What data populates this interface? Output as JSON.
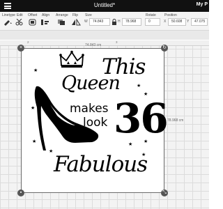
{
  "app": {
    "document_title": "Untitled*",
    "project_label": "My P"
  },
  "toolbar": {
    "groups": [
      {
        "label": "Linetype"
      },
      {
        "label": "Edit"
      },
      {
        "label": "Offset"
      },
      {
        "label": "Align"
      },
      {
        "label": "Arrange"
      },
      {
        "label": "Flip"
      },
      {
        "label": "Size"
      },
      {
        "label": "Rotate"
      },
      {
        "label": "Position"
      }
    ],
    "size": {
      "w_label": "W",
      "w_value": "74.843",
      "h_label": "H",
      "h_value": "78.968"
    },
    "rotate": {
      "value": "0"
    },
    "position": {
      "x_label": "X",
      "x_value": "50.608",
      "y_label": "Y",
      "y_value": "47.075"
    }
  },
  "ruler": {
    "label_left": "2",
    "label_right": "3"
  },
  "selection": {
    "width_readout": "74.843 cm",
    "height_readout": "78.968 cm"
  },
  "artwork": {
    "line1": "This",
    "line2": "Queen",
    "line3": "makes",
    "line4": "look",
    "number": "36",
    "line5": "Fabulous"
  },
  "icons": {
    "menu": "hamburger-icon",
    "crown": "crown-icon",
    "shoe": "high-heel-shoe-icon",
    "close": "close-icon",
    "rotate": "rotate-icon",
    "lock": "lock-icon",
    "resize": "resize-icon",
    "star": "star-icon"
  },
  "colors": {
    "titlebar": "#111111",
    "canvas": "#f3f3f3",
    "artwork": "#000000",
    "handles": "#555555"
  }
}
